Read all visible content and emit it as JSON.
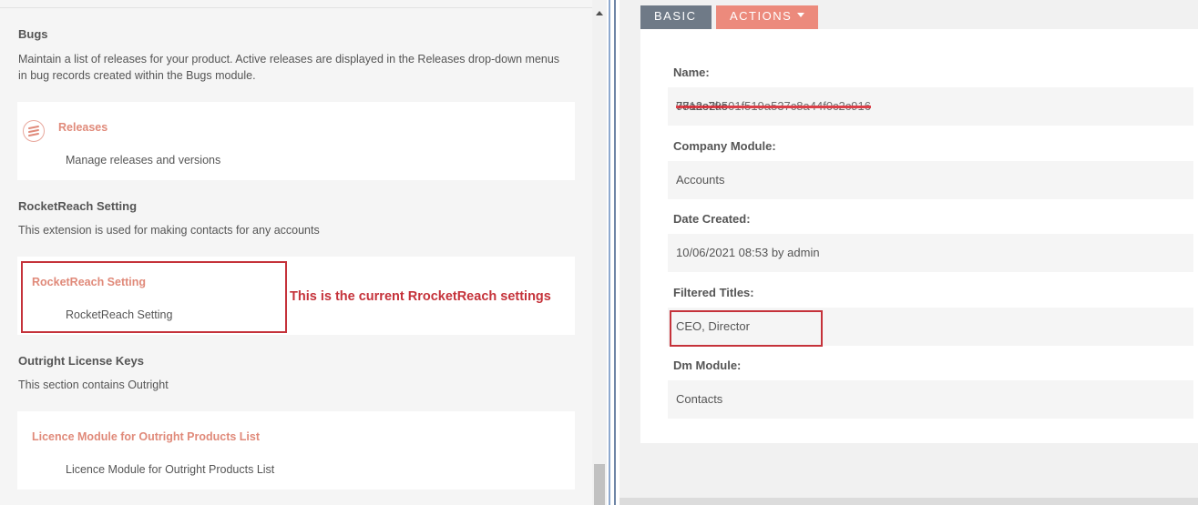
{
  "left": {
    "bugs": {
      "title": "Bugs",
      "desc_line1": "Maintain a list of releases for your product. Active releases are displayed in the Releases drop-down menus",
      "desc_line2": "in bug records created within the Bugs module.",
      "link": "Releases",
      "link_desc": "Manage releases and versions",
      "icon": "releases-icon"
    },
    "rocketreach": {
      "title": "RocketReach Setting",
      "desc": "This extension is used for making contacts for any accounts",
      "link": "RocketReach Setting",
      "link_desc": "RocketReach Setting"
    },
    "annotation": "This is the current RrocketReach settings",
    "outright": {
      "title": "Outright License Keys",
      "desc": "This section contains Outright",
      "link": "Licence Module for Outright Products List",
      "link_desc": "Licence Module for Outright Products List"
    }
  },
  "right": {
    "tabs": {
      "basic": "BASIC",
      "actions": "ACTIONS"
    },
    "fields": {
      "name": {
        "label": "Name:",
        "value": "78a2e2kc",
        "redacted": "071ac79501f519a537c8a44f0c2c916"
      },
      "company_module": {
        "label": "Company Module:",
        "value": "Accounts"
      },
      "date_created": {
        "label": "Date Created:",
        "value": "10/06/2021 08:53 by admin"
      },
      "filtered_titles": {
        "label": "Filtered Titles:",
        "value": "CEO, Director"
      },
      "dm_module": {
        "label": "Dm Module:",
        "value": "Contacts"
      }
    }
  },
  "colors": {
    "link": "#e08a7a",
    "annotation": "#c5323a",
    "tab_basic": "#6f7a87",
    "tab_actions": "#ec8a7c"
  }
}
